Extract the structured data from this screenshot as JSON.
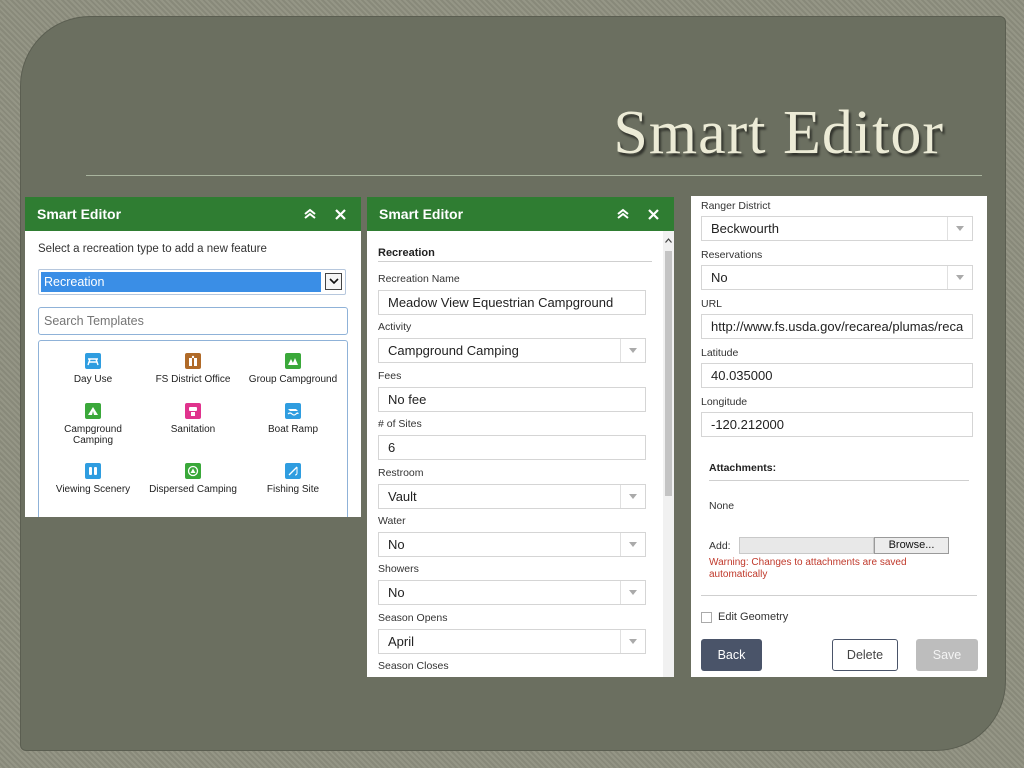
{
  "slide": {
    "title": "Smart Editor"
  },
  "panel1": {
    "title": "Smart Editor",
    "instruction": "Select a recreation type to add a new feature",
    "select_value": "Recreation",
    "search_placeholder": "Search Templates",
    "templates": [
      {
        "label": "Day Use",
        "icon": "picnic-table-icon",
        "color": "#2f9de0"
      },
      {
        "label": "FS District Office",
        "icon": "district-office-icon",
        "color": "#b06a28"
      },
      {
        "label": "Group Campground",
        "icon": "group-tent-icon",
        "color": "#3aa83a"
      },
      {
        "label": "Campground Camping",
        "icon": "tent-icon",
        "color": "#3aa83a"
      },
      {
        "label": "Sanitation",
        "icon": "sanitation-icon",
        "color": "#e0338d"
      },
      {
        "label": "Boat Ramp",
        "icon": "boat-ramp-icon",
        "color": "#2f9de0"
      },
      {
        "label": "Viewing Scenery",
        "icon": "binoculars-icon",
        "color": "#2f9de0"
      },
      {
        "label": "Dispersed Camping",
        "icon": "dispersed-camping-icon",
        "color": "#3aa83a"
      },
      {
        "label": "Fishing Site",
        "icon": "fishing-icon",
        "color": "#2f9de0"
      }
    ]
  },
  "panel2": {
    "title": "Smart Editor",
    "section": "Recreation",
    "fields": [
      {
        "label": "Recreation Name",
        "value": "Meadow View Equestrian Campground",
        "dropdown": false
      },
      {
        "label": "Activity",
        "value": "Campground Camping",
        "dropdown": true
      },
      {
        "label": "Fees",
        "value": "No fee",
        "dropdown": false
      },
      {
        "label": "# of Sites",
        "value": "6",
        "dropdown": false
      },
      {
        "label": "Restroom",
        "value": "Vault",
        "dropdown": true
      },
      {
        "label": "Water",
        "value": "No",
        "dropdown": true
      },
      {
        "label": "Showers",
        "value": "No",
        "dropdown": true
      },
      {
        "label": "Season Opens",
        "value": "April",
        "dropdown": true
      },
      {
        "label": "Season Closes",
        "value": "",
        "dropdown": true
      }
    ]
  },
  "panel3": {
    "fields": [
      {
        "label": "Ranger District",
        "value": "Beckwourth",
        "dropdown": true
      },
      {
        "label": "Reservations",
        "value": "No",
        "dropdown": true
      },
      {
        "label": "URL",
        "value": "http://www.fs.usda.gov/recarea/plumas/reca",
        "dropdown": false
      },
      {
        "label": "Latitude",
        "value": "40.035000",
        "dropdown": false
      },
      {
        "label": "Longitude",
        "value": "-120.212000",
        "dropdown": false
      }
    ],
    "attachments_title": "Attachments:",
    "attachments_none": "None",
    "add_label": "Add:",
    "browse_label": "Browse...",
    "warning": "Warning: Changes to attachments are saved automatically",
    "edit_geometry_label": "Edit Geometry",
    "back_label": "Back",
    "delete_label": "Delete",
    "save_label": "Save"
  }
}
